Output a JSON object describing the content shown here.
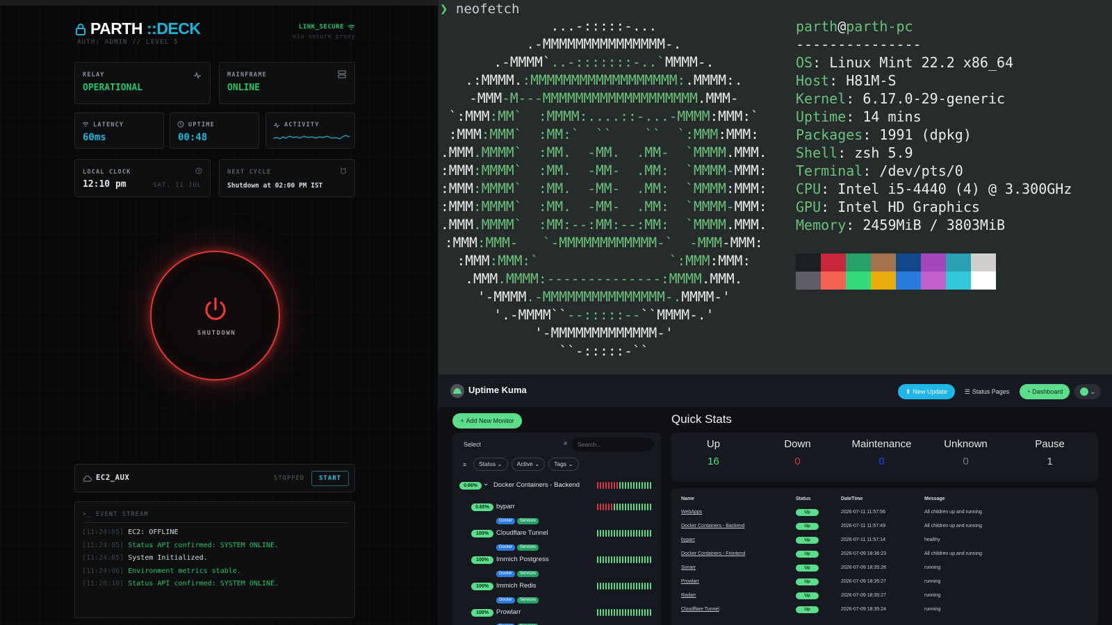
{
  "deck": {
    "brand_a": "PARTH",
    "brand_b": "::DECK",
    "auth": "AUTH: ADMIN // LEVEL 5",
    "link_secure": "LINK_SECURE",
    "proxy": "via secure proxy",
    "relay": {
      "label": "RELAY",
      "value": "OPERATIONAL"
    },
    "mainframe": {
      "label": "MAINFRAME",
      "value": "ONLINE"
    },
    "latency": {
      "label": "LATENCY",
      "value": "60ms"
    },
    "uptime": {
      "label": "UPTIME",
      "value": "00:48"
    },
    "activity": {
      "label": "ACTIVITY"
    },
    "clock": {
      "label": "LOCAL CLOCK",
      "time": "12:10 pm",
      "date": "SAT, 11 JUL"
    },
    "next": {
      "label": "NEXT CYCLE",
      "value": "Shutdown at 02:00 PM IST"
    },
    "power": {
      "label": "SHUTDOWN"
    },
    "ec2": {
      "name": "EC2_AUX",
      "status": "STOPPED",
      "button": "START"
    },
    "events": {
      "title": "EVENT STREAM",
      "lines": [
        {
          "ts": "[11:24:05]",
          "msg": "EC2: OFFLINE",
          "color": "#d8dcdf"
        },
        {
          "ts": "[11:24:05]",
          "msg": "Status API confirmed: SYSTEM ONLINE.",
          "color": "#27c46c"
        },
        {
          "ts": "[11:24:05]",
          "msg": "System Initialized.",
          "color": "#d8dcdf"
        },
        {
          "ts": "[11:24:06]",
          "msg": "Environment metrics stable.",
          "color": "#27c46c"
        },
        {
          "ts": "[11:26:10]",
          "msg": "Status API confirmed: SYSTEM ONLINE.",
          "color": "#27c46c"
        }
      ]
    }
  },
  "terminal": {
    "prompt_symbol": "❯",
    "command": "neofetch",
    "user": "parth",
    "host": "parth-pc",
    "separator": "---------------",
    "info": [
      {
        "key": "OS",
        "value": "Linux Mint 22.2 x86_64"
      },
      {
        "key": "Host",
        "value": "H81M-S"
      },
      {
        "key": "Kernel",
        "value": "6.17.0-29-generic"
      },
      {
        "key": "Uptime",
        "value": "14 mins"
      },
      {
        "key": "Packages",
        "value": "1991 (dpkg)"
      },
      {
        "key": "Shell",
        "value": "zsh 5.9"
      },
      {
        "key": "Terminal",
        "value": "/dev/pts/0"
      },
      {
        "key": "CPU",
        "value": "Intel i5-4440 (4) @ 3.300GHz"
      },
      {
        "key": "GPU",
        "value": "Intel HD Graphics"
      },
      {
        "key": "Memory",
        "value": "2459MiB / 3803MiB"
      }
    ],
    "ascii": [
      [
        [
          "w",
          "...-:::::-..."
        ]
      ],
      [
        [
          "w",
          ".-MMMMMMMMMMMMMMM-."
        ]
      ],
      [
        [
          "w",
          ".-MMMM`"
        ],
        [
          "g",
          "..-:::::::-..`"
        ],
        [
          "w",
          "MMMM-."
        ]
      ],
      [
        [
          "w",
          ".:MMMM."
        ],
        [
          "g",
          ":MMMMMMMMMMMMMMMMMM:"
        ],
        [
          "w",
          ".MMMM:."
        ]
      ],
      [
        [
          "w",
          "-MMM"
        ],
        [
          "g",
          "-M---MMMMMMMMMMMMMMMMMMM"
        ],
        [
          "w",
          ".MMM-"
        ]
      ],
      [
        [
          "w",
          "`:MMM"
        ],
        [
          "g",
          ":MM`  :MMMM:....::-...-MMMM"
        ],
        [
          "w",
          ":MMM:`"
        ]
      ],
      [
        [
          "w",
          ":MMM"
        ],
        [
          "g",
          ":MMM`  :MM:`  ``    ``  `:MMM"
        ],
        [
          "w",
          ":MMM:"
        ]
      ],
      [
        [
          "w",
          ".MMM"
        ],
        [
          "g",
          ".MMMM`  :MM.  -MM.  .MM-  `MMMM"
        ],
        [
          "w",
          ".MMM."
        ]
      ],
      [
        [
          "w",
          ":MMM"
        ],
        [
          "g",
          ":MMMM`  :MM.  -MM-  .MM:  `MMMM-"
        ],
        [
          "w",
          "MMM:"
        ]
      ],
      [
        [
          "w",
          ":MMM"
        ],
        [
          "g",
          ":MMMM`  :MM.  -MM-  .MM:  `MMMM"
        ],
        [
          "w",
          ":MMM:"
        ]
      ],
      [
        [
          "w",
          ":MMM"
        ],
        [
          "g",
          ":MMMM`  :MM.  -MM-  .MM:  `MMMM-"
        ],
        [
          "w",
          "MMM:"
        ]
      ],
      [
        [
          "w",
          ".MMM"
        ],
        [
          "g",
          ".MMMM`  :MM:--:MM:--:MM:  `MMMM"
        ],
        [
          "w",
          ".MMM."
        ]
      ],
      [
        [
          "w",
          ":MMM"
        ],
        [
          "g",
          ":MMM-   `-MMMMMMMMMMMM-`  -MMM"
        ],
        [
          "w",
          "-MMM:"
        ]
      ],
      [
        [
          "w",
          ":MMM"
        ],
        [
          "g",
          ":MMM:`                `:MMM"
        ],
        [
          "w",
          ":MMM:"
        ]
      ],
      [
        [
          "w",
          ".MMM"
        ],
        [
          "g",
          ".MMMM:--------------:MMMM"
        ],
        [
          "w",
          ".MMM."
        ]
      ],
      [
        [
          "w",
          "'-MMMM"
        ],
        [
          "g",
          ".-MMMMMMMMMMMMMMM-."
        ],
        [
          "w",
          "MMMM-'"
        ]
      ],
      [
        [
          "w",
          "'.-MMMM``"
        ],
        [
          "g",
          "--:::::--"
        ],
        [
          "w",
          "``MMMM-.'"
        ]
      ],
      [
        [
          "w",
          "'-MMMMMMMMMMMMM-'"
        ]
      ],
      [
        [
          "w",
          "``-:::::-``"
        ]
      ]
    ],
    "palette": [
      "#1c1f21",
      "#c8273a",
      "#26a269",
      "#a2734c",
      "#12488b",
      "#a347ba",
      "#2aa1b3",
      "#d0cfcc",
      "#5e5c64",
      "#f66151",
      "#33da7a",
      "#e9ad0c",
      "#2a7bde",
      "#c061cb",
      "#33c7de",
      "#ffffff"
    ]
  },
  "kuma": {
    "title": "Uptime Kuma",
    "new_update": "New Update",
    "status_pages": "Status Pages",
    "dashboard": "Dashboard",
    "add_monitor": "Add New Monitor",
    "select": "Select",
    "search_placeholder": "Search...",
    "filters": [
      "Status",
      "Active",
      "Tags"
    ],
    "group": {
      "pct": "0.66%",
      "name": "Docker Containers - Backend"
    },
    "monitors": [
      {
        "pct": "0.65%",
        "name": "byparr",
        "tags": [
          "Docker",
          "Services"
        ]
      },
      {
        "pct": "100%",
        "name": "Cloudflare Tunnel",
        "tags": [
          "Docker",
          "Services"
        ]
      },
      {
        "pct": "100%",
        "name": "Immich Postgress",
        "tags": [
          "Docker",
          "Services"
        ]
      },
      {
        "pct": "100%",
        "name": "Immich Redis",
        "tags": [
          "Docker",
          "Services"
        ]
      },
      {
        "pct": "100%",
        "name": "Prowlarr",
        "tags": [
          "Docker",
          "Services"
        ]
      }
    ],
    "quick_title": "Quick Stats",
    "stats": [
      {
        "label": "Up",
        "value": "16",
        "color": "#5cdd8b"
      },
      {
        "label": "Down",
        "value": "0",
        "color": "#dc3545"
      },
      {
        "label": "Maintenance",
        "value": "0",
        "color": "#1747f5"
      },
      {
        "label": "Unknown",
        "value": "0",
        "color": "#7b8088"
      },
      {
        "label": "Pause",
        "value": "1",
        "color": "#c4c8cd"
      }
    ],
    "table_headers": [
      "Name",
      "Status",
      "DateTime",
      "Message"
    ],
    "rows": [
      {
        "name": "WebApps",
        "status": "Up",
        "time": "2026-07-11 11:57:56",
        "msg": "All children up and running"
      },
      {
        "name": "Docker Containers - Backend",
        "status": "Up",
        "time": "2026-07-11 11:57:49",
        "msg": "All children up and running"
      },
      {
        "name": "byparr",
        "status": "Up",
        "time": "2026-07-11 11:57:14",
        "msg": "healthy"
      },
      {
        "name": "Docker Containers - Frontend",
        "status": "Up",
        "time": "2026-07-09 18:36:23",
        "msg": "All children up and running"
      },
      {
        "name": "Sonarr",
        "status": "Up",
        "time": "2026-07-09 18:35:28",
        "msg": "running"
      },
      {
        "name": "Prowlarr",
        "status": "Up",
        "time": "2026-07-09 18:35:27",
        "msg": "running"
      },
      {
        "name": "Radarr",
        "status": "Up",
        "time": "2026-07-09 18:35:27",
        "msg": "running"
      },
      {
        "name": "Cloudflare Tunnel",
        "status": "Up",
        "time": "2026-07-09 18:35:24",
        "msg": "running"
      }
    ]
  }
}
